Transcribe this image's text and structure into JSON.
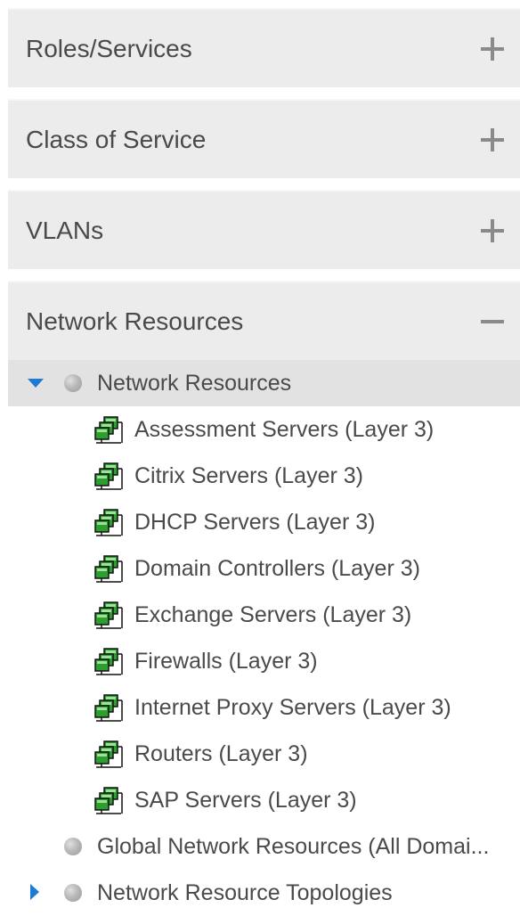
{
  "panels": [
    {
      "title": "Roles/Services",
      "state": "collapsed",
      "toggle_icon": "plus-icon"
    },
    {
      "title": "Class of Service",
      "state": "collapsed",
      "toggle_icon": "plus-icon"
    },
    {
      "title": "VLANs",
      "state": "collapsed",
      "toggle_icon": "plus-icon"
    },
    {
      "title": "Network Resources",
      "state": "expanded",
      "toggle_icon": "minus-icon"
    }
  ],
  "tree": {
    "root": {
      "label": "Network Resources",
      "expanded": true,
      "selected": true
    },
    "children": [
      {
        "label": "Assessment Servers (Layer 3)",
        "icon": "network-resource-icon"
      },
      {
        "label": "Citrix Servers (Layer 3)",
        "icon": "network-resource-icon"
      },
      {
        "label": "DHCP Servers (Layer 3)",
        "icon": "network-resource-icon"
      },
      {
        "label": "Domain Controllers (Layer 3)",
        "icon": "network-resource-icon"
      },
      {
        "label": "Exchange Servers (Layer 3)",
        "icon": "network-resource-icon"
      },
      {
        "label": "Firewalls (Layer 3)",
        "icon": "network-resource-icon"
      },
      {
        "label": "Internet Proxy Servers (Layer 3)",
        "icon": "network-resource-icon"
      },
      {
        "label": "Routers (Layer 3)",
        "icon": "network-resource-icon"
      },
      {
        "label": "SAP Servers (Layer 3)",
        "icon": "network-resource-icon"
      }
    ],
    "global": {
      "label": "Global Network Resources (All Domai..."
    },
    "topologies": {
      "label": "Network Resource Topologies",
      "expanded": false
    }
  },
  "colors": {
    "panel_bg": "#ececec",
    "selected_row_bg": "#e2e2e2",
    "caret_blue": "#1f7ad6",
    "text": "#4a4a4a"
  }
}
